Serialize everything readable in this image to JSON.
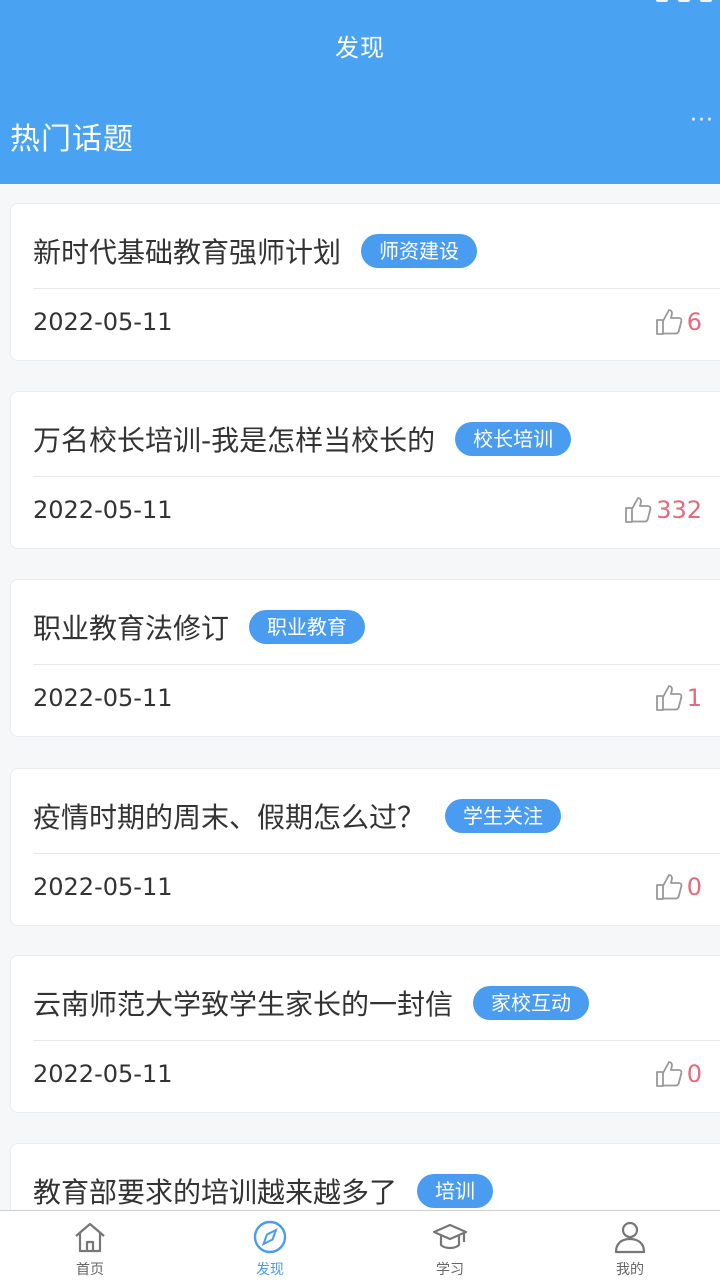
{
  "header": {
    "title": "发现",
    "section_title": "热门话题",
    "more_icon": "more-icon"
  },
  "topics": [
    {
      "title": "新时代基础教育强师计划",
      "tag": "师资建设",
      "date": "2022-05-11",
      "likes": "6"
    },
    {
      "title": "万名校长培训-我是怎样当校长的",
      "tag": "校长培训",
      "date": "2022-05-11",
      "likes": "332"
    },
    {
      "title": "职业教育法修订",
      "tag": "职业教育",
      "date": "2022-05-11",
      "likes": "1"
    },
    {
      "title": "疫情时期的周末、假期怎么过？",
      "tag": "学生关注",
      "date": "2022-05-11",
      "likes": "0"
    },
    {
      "title": "云南师范大学致学生家长的一封信",
      "tag": "家校互动",
      "date": "2022-05-11",
      "likes": "0"
    },
    {
      "title": "教育部要求的培训越来越多了",
      "tag": "培训",
      "date": "",
      "likes": ""
    }
  ],
  "tabbar": {
    "items": [
      {
        "label": "首页",
        "icon": "home-icon",
        "active": false
      },
      {
        "label": "发现",
        "icon": "compass-icon",
        "active": true
      },
      {
        "label": "学习",
        "icon": "graduation-cap-icon",
        "active": false
      },
      {
        "label": "我的",
        "icon": "user-icon",
        "active": false
      }
    ]
  },
  "colors": {
    "header_bg": "#4aa3f2",
    "tag_bg": "#4a9cf0",
    "like_count": "#e56a7d",
    "active_tab": "#4a9cf0"
  }
}
